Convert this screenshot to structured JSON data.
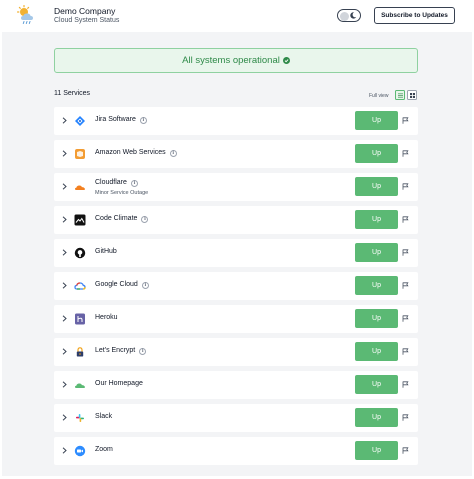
{
  "header": {
    "company": "Demo Company",
    "subtitle": "Cloud System Status",
    "subscribe_label": "Subscribe to Updates"
  },
  "banner": {
    "text": "All systems operational",
    "icon": "check-circle-icon",
    "color": "#2f8a49"
  },
  "toolbar": {
    "count": "11 Services",
    "view_label": "Full view"
  },
  "colors": {
    "status_up": "#5bb974",
    "background": "#f3f4f6"
  },
  "services": [
    {
      "name": "Jira Software",
      "info": true,
      "status": "Up",
      "icon": "jira-icon"
    },
    {
      "name": "Amazon Web Services",
      "info": true,
      "status": "Up",
      "icon": "aws-icon"
    },
    {
      "name": "Cloudflare",
      "info": true,
      "sub": "Minor Service Outage",
      "status": "Up",
      "icon": "cloudflare-icon"
    },
    {
      "name": "Code Climate",
      "info": true,
      "status": "Up",
      "icon": "code-climate-icon"
    },
    {
      "name": "GitHub",
      "info": false,
      "status": "Up",
      "icon": "github-icon"
    },
    {
      "name": "Google Cloud",
      "info": true,
      "status": "Up",
      "icon": "google-cloud-icon"
    },
    {
      "name": "Heroku",
      "info": false,
      "status": "Up",
      "icon": "heroku-icon"
    },
    {
      "name": "Let's Encrypt",
      "info": true,
      "status": "Up",
      "icon": "lets-encrypt-icon"
    },
    {
      "name": "Our Homepage",
      "info": false,
      "status": "Up",
      "icon": "homepage-icon"
    },
    {
      "name": "Slack",
      "info": false,
      "status": "Up",
      "icon": "slack-icon"
    },
    {
      "name": "Zoom",
      "info": false,
      "status": "Up",
      "icon": "zoom-icon"
    }
  ]
}
